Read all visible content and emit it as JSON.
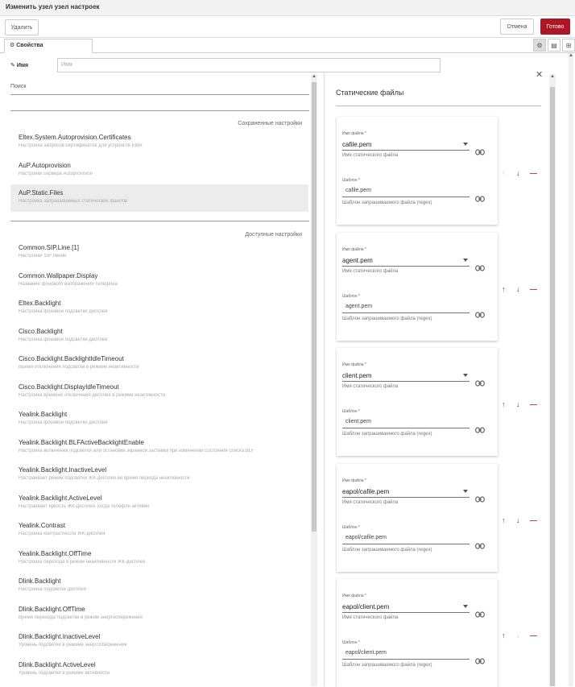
{
  "window": {
    "title": "Изменить узел узел настроек"
  },
  "toolbar": {
    "delete_label": "Удалить",
    "cancel_label": "Отмена",
    "done_label": "Готово"
  },
  "tabs": {
    "properties_label": "Свойства"
  },
  "name_field": {
    "label": "Имя",
    "placeholder": "Имя"
  },
  "search": {
    "label": "Поиск"
  },
  "saved": {
    "heading": "Сохраненные настройки",
    "items": [
      {
        "title": "Eltex.System.Autoprovision.Certificates",
        "desc": "Настройка запросов сертификатов для устройств Eltex"
      },
      {
        "title": "AuP.Autoprovision",
        "desc": "Настройки сервера Autoprovision"
      },
      {
        "title": "AuP.Static.Files",
        "desc": "Настройка запрашиваемых статических файлов"
      }
    ]
  },
  "available": {
    "heading": "Доступные настройки",
    "items": [
      {
        "title": "Common.SIP.Line.[1]",
        "desc": "Настройки SIP линии"
      },
      {
        "title": "Common.Wallpaper.Display",
        "desc": "Название фонового изображения телефона"
      },
      {
        "title": "Eltex.Backlight",
        "desc": "Настройка фоновой подсветки дисплея"
      },
      {
        "title": "Cisco.Backlight",
        "desc": "Настройка фоновой подсветки дисплея"
      },
      {
        "title": "Cisco.Backlight.BacklightIdleTimeout",
        "desc": "Время отключения подсветки в режиме неактивности"
      },
      {
        "title": "Cisco.Backlight.DisplayIdleTimeout",
        "desc": "Настройка времени отключения дисплея в режиме неактивности"
      },
      {
        "title": "Yealink.Backlight",
        "desc": "Настройка фоновой подсветки дисплея"
      },
      {
        "title": "Yealink.Backlight.BLFActiveBacklightEnable",
        "desc": "Настройка включения подсветки или остановки экранной заставки при изменении состояния списка BLF"
      },
      {
        "title": "Yealink.Backlight.InactiveLevel",
        "desc": "Настраивает режим подсветки ЖК-дисплея во время периода неактивности"
      },
      {
        "title": "Yealink.Backlight.ActiveLevel",
        "desc": "Настраивает яркость ЖК-дисплея, когда телефон активен"
      },
      {
        "title": "Yealink.Contrast",
        "desc": "Настройка контрастности ЖК-дисплея"
      },
      {
        "title": "Yealink.Backlight.OffTime",
        "desc": "Настройка перехода в режим неактивности ЖК-дисплея"
      },
      {
        "title": "Dlink.Backlight",
        "desc": "Настройка подсветки дисплея"
      },
      {
        "title": "Dlink.Backlight.OffTime",
        "desc": "Время перехода подсветки в режим энергосбережения"
      },
      {
        "title": "Dlink.Backlight.InactiveLevel",
        "desc": "Уровень подсветки в режиме энергосбережения"
      },
      {
        "title": "Dlink.Backlight.ActiveLevel",
        "desc": "Уровень подсветки в режиме активности"
      }
    ]
  },
  "static_files": {
    "title": "Статические файлы",
    "file_label": "Имя файла *",
    "file_help": "Имя статического файла",
    "pattern_label": "Шаблон *",
    "pattern_help": "Шаблон запрашиваемого файла (regex)",
    "entries": [
      {
        "file": "cafile.pem",
        "pattern": "cafile.pem"
      },
      {
        "file": "agent.pem",
        "pattern": "agent.pem"
      },
      {
        "file": "client.pem",
        "pattern": "client.pem"
      },
      {
        "file": "eapol/cafile.pem",
        "pattern": "eapol/cafile.pem"
      },
      {
        "file": "eapol/client.pem",
        "pattern": "eapol/client.pem"
      }
    ]
  },
  "icons": {
    "tab": "gear-icon",
    "name": "tag-icon",
    "link": "link-icon",
    "up": "arrow-up-icon",
    "down": "arrow-down-icon",
    "remove": "minus-icon",
    "close": "close-icon"
  },
  "colors": {
    "primary": "#ad1625",
    "remove": "#c0392b"
  }
}
